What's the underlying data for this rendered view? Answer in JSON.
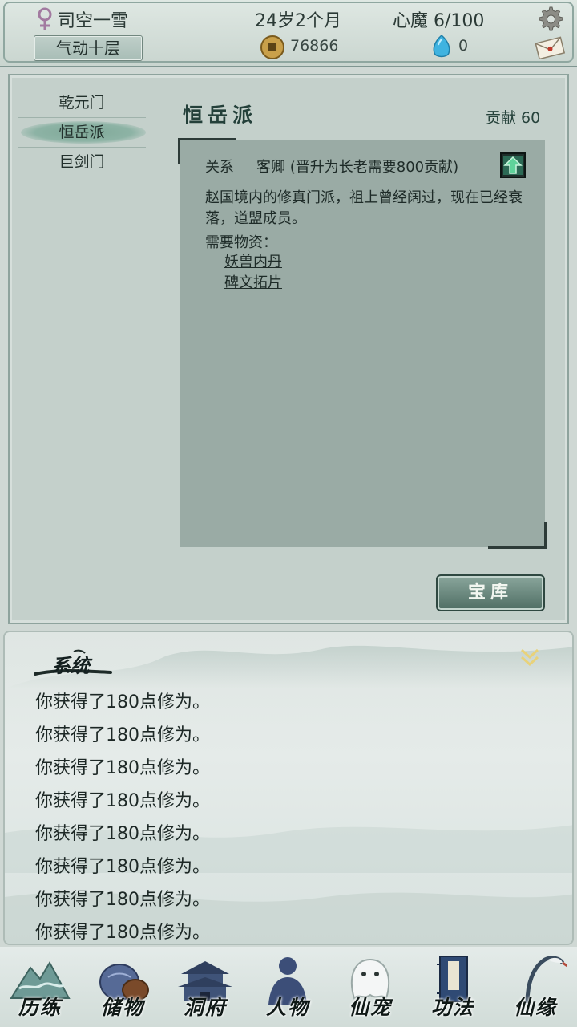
{
  "header": {
    "player_name": "司空一雪",
    "realm": "气动十层",
    "age": "24岁2个月",
    "heart_demon": "心魔  6/100",
    "coins": "76866",
    "gems": "0",
    "icons": [
      "female-symbol-icon",
      "settings-gear-icon",
      "copper-coin-icon",
      "spirit-gem-icon",
      "mail-icon"
    ]
  },
  "sects": {
    "list": [
      {
        "label": "乾元门",
        "selected": false
      },
      {
        "label": "恒岳派",
        "selected": true
      },
      {
        "label": "巨剑门",
        "selected": false
      }
    ],
    "title": "恒岳派",
    "contribution": "贡献 60",
    "relation_label": "关系",
    "relation_value": "客卿 (晋升为长老需要800贡献)",
    "description": "赵国境内的修真门派，祖上曾经阔过，现在已经衰落，道盟成员。",
    "needed_label": "需要物资：",
    "needed_items": [
      "妖兽内丹",
      "碑文拓片"
    ],
    "vault_button": "宝库"
  },
  "log": {
    "title": "系统",
    "lines": [
      "你获得了180点修为。",
      "你获得了180点修为。",
      "你获得了180点修为。",
      "你获得了180点修为。",
      "你获得了180点修为。",
      "你获得了180点修为。",
      "你获得了180点修为。",
      "你获得了180点修为。"
    ]
  },
  "nav": {
    "items": [
      {
        "label": "历练",
        "icon": "mountain-icon"
      },
      {
        "label": "储物",
        "icon": "storage-bag-icon"
      },
      {
        "label": "洞府",
        "icon": "cave-residence-icon"
      },
      {
        "label": "人物",
        "icon": "character-icon"
      },
      {
        "label": "仙宠",
        "icon": "spirit-pet-icon"
      },
      {
        "label": "功法",
        "icon": "technique-book-icon"
      },
      {
        "label": "仙缘",
        "icon": "crane-icon"
      }
    ]
  },
  "colors": {
    "panel": "#c4d0cb",
    "info_box": "#9aaba5",
    "accent": "#24403a",
    "selected_brush": "#7fa898"
  }
}
